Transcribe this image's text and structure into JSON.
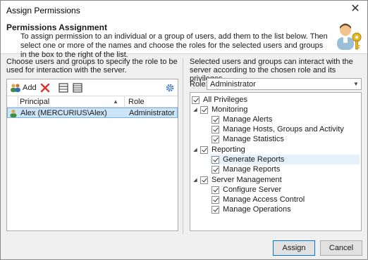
{
  "window": {
    "title": "Assign Permissions",
    "close_glyph": "✕"
  },
  "header": {
    "title": "Permissions Assignment",
    "description": "To assign permission to an individual or a group of users, add them to the list below. Then select one or more of the names and choose the roles for the selected users and groups in the box to the right of the list.",
    "badge_icon": "user-key-icon"
  },
  "left_panel": {
    "instructions": "Choose users and groups to specify the role to be used for interaction with the server.",
    "toolbar": {
      "add_label": "Add",
      "add_icon": "add-users-icon",
      "remove_icon": "remove-x-icon",
      "view1_icon": "view-grid-icon",
      "view2_icon": "view-list-icon",
      "settings_icon": "gear-icon"
    },
    "columns": {
      "principal": "Principal",
      "role": "Role"
    },
    "rows": [
      {
        "principal": "Alex (MERCURIUS\\Alex)",
        "role": "Administrator",
        "icon": "user-icon"
      }
    ]
  },
  "right_panel": {
    "instructions": "Selected users and groups can interact with the server according to the chosen role and its privileges.",
    "role_label": "Role:",
    "role_value": "Administrator",
    "tree": {
      "root": "All Privileges",
      "groups": [
        {
          "label": "Monitoring",
          "children": [
            "Manage Alerts",
            "Manage Hosts, Groups and Activity",
            "Manage Statistics"
          ]
        },
        {
          "label": "Reporting",
          "children": [
            "Generate Reports",
            "Manage Reports"
          ]
        },
        {
          "label": "Server Management",
          "children": [
            "Configure Server",
            "Manage Access Control",
            "Manage Operations"
          ]
        }
      ]
    }
  },
  "footer": {
    "assign_label": "Assign",
    "cancel_label": "Cancel"
  },
  "colors": {
    "accent": "#0078d7",
    "selection": "#cce4f7",
    "hover": "#e5f1fb"
  }
}
